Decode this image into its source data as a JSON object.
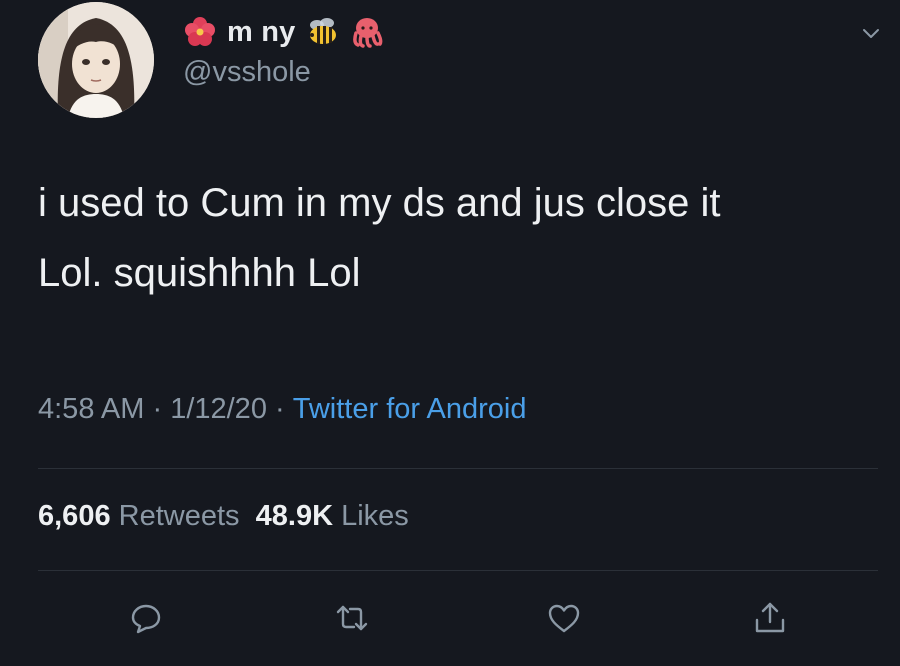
{
  "author": {
    "display_name": "m ny",
    "handle": "@vsshole",
    "name_emojis": [
      "hibiscus-icon",
      "bee-icon",
      "octopus-icon"
    ]
  },
  "tweet": {
    "text": "i used to Cum in my ds and jus close it\nLol. squishhhh Lol",
    "time": "4:58 AM",
    "sep1": " · ",
    "date": "1/12/20",
    "sep2": " · ",
    "source": "Twitter for Android"
  },
  "stats": {
    "retweets_count": "6,606",
    "retweets_label": " Retweets",
    "likes_count": "48.9K",
    "likes_label": " Likes"
  },
  "actions": [
    "reply-icon",
    "retweet-icon",
    "like-icon",
    "share-icon"
  ],
  "colors": {
    "background": "#15181f",
    "text": "#eef0f2",
    "secondary": "#8b98a5",
    "link": "#4a9fe8",
    "divider": "#2b3038"
  }
}
